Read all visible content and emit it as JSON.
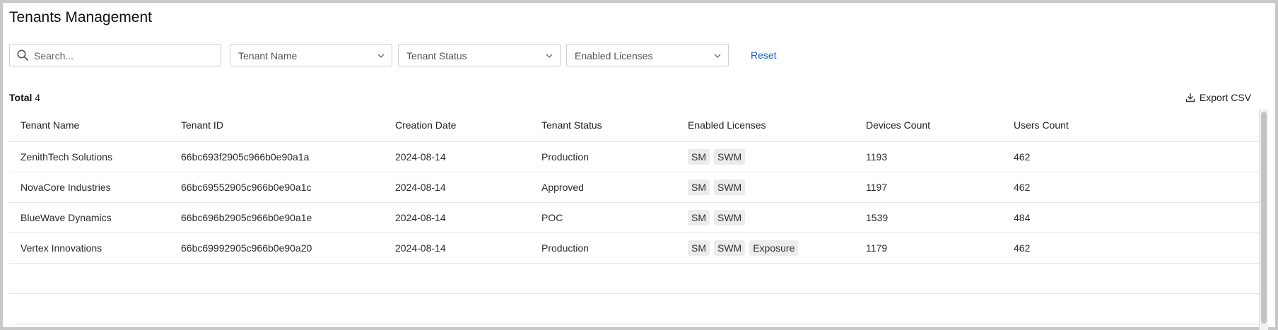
{
  "page": {
    "title": "Tenants Management"
  },
  "filters": {
    "search_placeholder": "Search...",
    "tenant_name": "Tenant Name",
    "tenant_status": "Tenant Status",
    "enabled_licenses": "Enabled Licenses",
    "reset_label": "Reset"
  },
  "summary": {
    "total_label": "Total",
    "total_count": "4"
  },
  "toolbar": {
    "export_label": "Export CSV"
  },
  "table": {
    "columns": [
      "Tenant Name",
      "Tenant ID",
      "Creation Date",
      "Tenant Status",
      "Enabled Licenses",
      "Devices Count",
      "Users Count"
    ],
    "rows": [
      {
        "name": "ZenithTech Solutions",
        "id": "66bc693f2905c966b0e90a1a",
        "date": "2024-08-14",
        "status": "Production",
        "licenses": [
          "SM",
          "SWM"
        ],
        "devices": "1193",
        "users": "462"
      },
      {
        "name": "NovaCore Industries",
        "id": "66bc69552905c966b0e90a1c",
        "date": "2024-08-14",
        "status": "Approved",
        "licenses": [
          "SM",
          "SWM"
        ],
        "devices": "1197",
        "users": "462"
      },
      {
        "name": "BlueWave Dynamics",
        "id": "66bc696b2905c966b0e90a1e",
        "date": "2024-08-14",
        "status": "POC",
        "licenses": [
          "SM",
          "SWM"
        ],
        "devices": "1539",
        "users": "484"
      },
      {
        "name": "Vertex Innovations",
        "id": "66bc69992905c966b0e90a20",
        "date": "2024-08-14",
        "status": "Production",
        "licenses": [
          "SM",
          "SWM",
          "Exposure"
        ],
        "devices": "1179",
        "users": "462"
      }
    ]
  },
  "colors": {
    "accent": "#1a5fc9",
    "tag_bg": "#ececec",
    "border": "#cfcfcf"
  }
}
